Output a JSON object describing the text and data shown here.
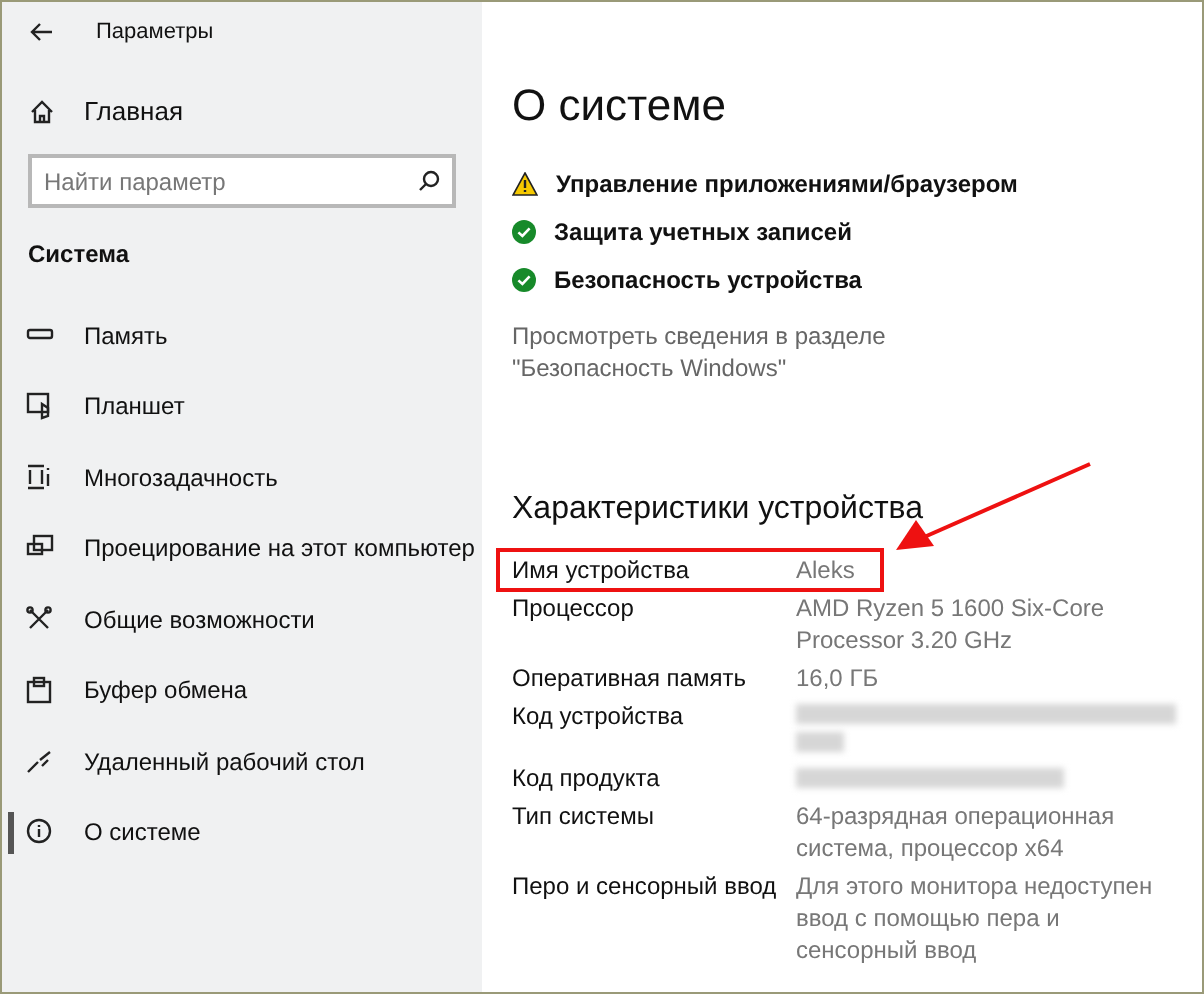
{
  "window": {
    "title": "Параметры"
  },
  "sidebar": {
    "home": "Главная",
    "search": {
      "placeholder": "Найти параметр"
    },
    "section": "Система",
    "items": [
      {
        "label": "Память",
        "selected": false
      },
      {
        "label": "Планшет",
        "selected": false
      },
      {
        "label": "Многозадачность",
        "selected": false
      },
      {
        "label": "Проецирование на этот компьютер",
        "selected": false
      },
      {
        "label": "Общие возможности",
        "selected": false
      },
      {
        "label": "Буфер обмена",
        "selected": false
      },
      {
        "label": "Удаленный рабочий стол",
        "selected": false
      },
      {
        "label": "О системе",
        "selected": true
      }
    ]
  },
  "main": {
    "title": "О системе",
    "security": [
      {
        "label": "Управление приложениями/браузером",
        "kind": "warning"
      },
      {
        "label": "Защита учетных записей",
        "kind": "ok"
      },
      {
        "label": "Безопасность устройства",
        "kind": "ok"
      }
    ],
    "security_link": "Просмотреть сведения в разделе \"Безопасность Windows\"",
    "specs_title": "Характеристики устройства",
    "specs": [
      {
        "label": "Имя устройства",
        "value": "Aleks",
        "kind": "text",
        "highlighted": true
      },
      {
        "label": "Процессор",
        "value": "AMD Ryzen 5 1600 Six-Core Processor 3.20 GHz",
        "kind": "text",
        "highlighted": false
      },
      {
        "label": "Оперативная память",
        "value": "16,0 ГБ",
        "kind": "text",
        "highlighted": false
      },
      {
        "label": "Код устройства",
        "kind": "redacted-long",
        "highlighted": false
      },
      {
        "label": "Код продукта",
        "kind": "redacted-short",
        "highlighted": false
      },
      {
        "label": "Тип системы",
        "value": "64-разрядная операционная система, процессор x64",
        "kind": "text",
        "highlighted": false
      },
      {
        "label": "Перо и сенсорный ввод",
        "value": "Для этого монитора недоступен ввод с помощью пера и сенсорный ввод",
        "kind": "text",
        "highlighted": false
      }
    ]
  }
}
